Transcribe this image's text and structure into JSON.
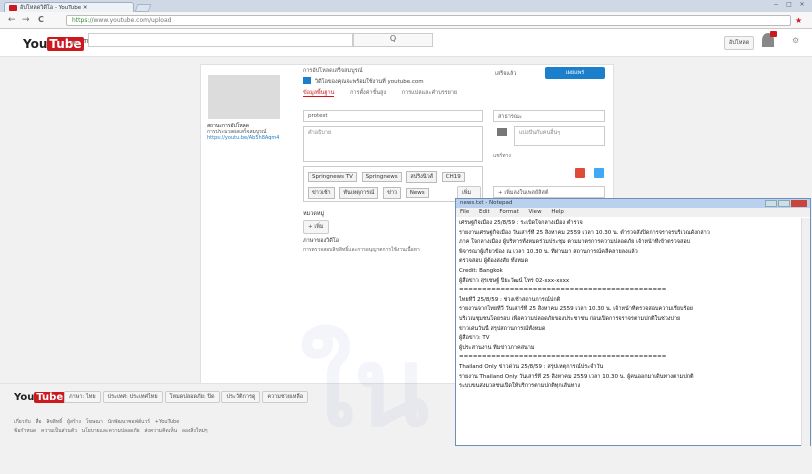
{
  "browser": {
    "tab_title": "อัปโหลดวิดีโอ - YouTube",
    "url_prefix": "https://",
    "url_rest": "www.youtube.com/upload",
    "back": "←",
    "forward": "→",
    "reload": "C",
    "minimize": "−",
    "maximize": "□",
    "close": "✕",
    "star": "★",
    "menu": "≡"
  },
  "youtube": {
    "logo_text": "You",
    "logo_tube": "Tube",
    "logo_region": "TH",
    "search_button": "Q",
    "upload_button": "อัปโหลด",
    "thumb_title": "สถานะการอัปโหลด",
    "thumb_sub": "การประมวลผลเสร็จสมบูรณ์",
    "thumb_link": "https://youtu.be/Ab5h8Aqm4",
    "status_line": "การอัปโหลดเสร็จสมบูรณ์",
    "info_note": "วิดีโอของคุณจะพร้อมใช้งานที่ youtube.com",
    "publish_button": "เผยแพร่",
    "done_label": "เสร็จแล้ว",
    "tabs": [
      "ข้อมูลพื้นฐาน",
      "การตั้งค่าขั้นสูง",
      "การแปลและคำบรรยาย"
    ],
    "title_value": "protest",
    "description_placeholder": "คำอธิบาย",
    "privacy_value": "สาธารณะ",
    "share_placeholder": "แบ่งปันกับคนอื่นๆ",
    "tags": [
      "Springnews TV",
      "Springnews",
      "สปริงนิวส์",
      "CH19",
      "ข่าวเช้า",
      "ทันเหตุการณ์",
      "ข่าว",
      "News"
    ],
    "suggest_button": "เพิ่ม",
    "playlist_add": "+ เพิ่มลงในเพลย์ลิสต์",
    "category_label": "หมวดหมู่",
    "add_button": "+ เพิ่ม",
    "translate_label": "ภาษาของวิดีโอ",
    "translate_text": "การตรวจสอบลิขสิทธิ์และการอนุญาตการใช้งานเนื้อหา",
    "social_label": "แชร์ทาง"
  },
  "notepad": {
    "title": "news.txt - Notepad",
    "menu": [
      "File",
      "Edit",
      "Format",
      "View",
      "Help"
    ],
    "lines": [
      "เศรษฐกิจเมือง 25/8/59 : ระเบิดใจกลางเมือง ตำรวจ",
      "รายงานเศรษฐกิจเมือง วันเสาร์ที่ 25 สิงหาคม 2559 เวลา 10.30 น. ตำรวจสั่งปิดการจราจรบริเวณดังกล่าว",
      "ภาค ใจกลางเมือง ผู้บริหารทั้งหมดร่วมประชุม ตามมาตรการความปลอดภัย เจ้าหน้าที่เข้าตรวจสอบ",
      "พิจารณาผู้เกี่ยวข้อง ณ เวลา 10.30 น. ที่ผ่านมา สถานการณ์คลี่คลายลงแล้ว",
      "ตรวจสอบ ผู้ต้องสงสัย ทั้งหมด",
      "Credit: Bangkok",
      "ผู้สื่อข่าว สุรเชษฐ์ ปิยะวัฒน์ โทร 02-xxx-xxxx",
      "=============================================",
      "ไทยทีวี 25/8/59 : ช่วงเช้าสถานการณ์ปกติ",
      "รายงานจากไทยทีวี วันเสาร์ที่ 25 สิงหาคม 2559 เวลา 10.30 น. เจ้าหน้าที่ตรวจสอบความเรียบร้อย",
      "บริเวณชุมชนโดยรอบ เพื่อความปลอดภัยของประชาชน ก่อนเปิดการจราจรตามปกติในช่วงบ่าย",
      "ข่าวเด่นวันนี้ สรุปสถานการณ์ทั้งหมด",
      "ผู้สื่อข่าว: TV",
      "ผู้ประสานงาน ทีมข่าวภาคสนาม",
      "=============================================",
      "Thailand Only ข่าวด่วน 25/8/59 : สรุปเหตุการณ์ประจำวัน",
      "รายงาน Thailand Only วันเสาร์ที่ 25 สิงหาคม 2559 เวลา 10.30 น. ผู้คนออกมาเดินทางตามปกติ",
      "ระบบขนส่งมวลชนเปิดให้บริการตามปกติทุกเส้นทาง"
    ]
  },
  "footer": {
    "logo_text": "You",
    "logo_tube": "Tube",
    "buttons": [
      "ภาษา: ไทย",
      "ประเทศ: ประเทศไทย",
      "โหมดปลอดภัย: ปิด",
      "ประวัติการดู",
      "ความช่วยเหลือ"
    ],
    "links_row1": [
      "เกี่ยวกับ",
      "สื่อ",
      "ลิขสิทธิ์",
      "ผู้สร้าง",
      "โฆษณา",
      "นักพัฒนาซอฟต์แวร์",
      "+YouTube"
    ],
    "links_row2": [
      "ข้อกำหนด",
      "ความเป็นส่วนตัว",
      "นโยบายและความปลอดภัย",
      "ส่งความคิดเห็น",
      "ลองสิ่งใหม่ๆ"
    ]
  },
  "watermark": "ใน โล"
}
